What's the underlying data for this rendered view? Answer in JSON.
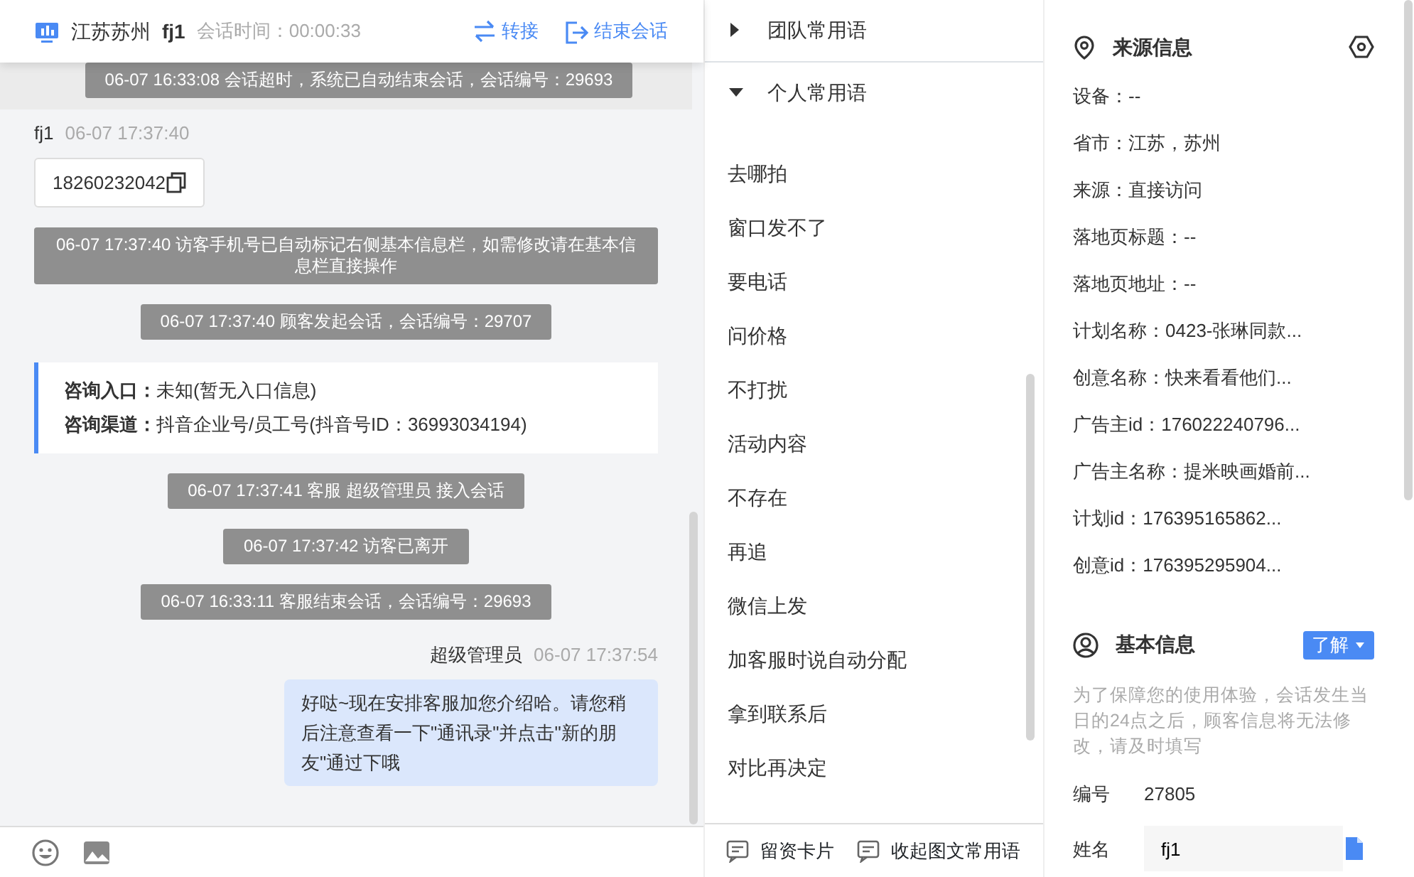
{
  "header": {
    "region": "江苏苏州",
    "visitor": "fj1",
    "session_time": "会话时间：00:00:33",
    "actions": [
      {
        "kind": "transfer",
        "label": "转接"
      },
      {
        "kind": "end",
        "label": "结束会话"
      }
    ]
  },
  "messages": [
    {
      "kind": "system",
      "text": "06-07 16:33:08 会话超时，系统已自动结束会话，会话编号：29693"
    },
    {
      "kind": "visitor",
      "sender": "fj1",
      "time": "06-07 17:37:40",
      "text": "18260232042"
    },
    {
      "kind": "system",
      "text": "06-07 17:37:40 访客手机号已自动标记右侧基本信息栏，如需修改请在基本信息栏直接操作"
    },
    {
      "kind": "system",
      "text": "06-07 17:37:40 顾客发起会话，会话编号：29707"
    },
    {
      "kind": "channel",
      "rows": [
        {
          "label": "咨询入口：",
          "value": "未知(暂无入口信息)"
        },
        {
          "label": "咨询渠道：",
          "value": "抖音企业号/员工号(抖音号ID：36993034194)"
        }
      ]
    },
    {
      "kind": "system",
      "text": "06-07 17:37:41 客服 超级管理员 接入会话"
    },
    {
      "kind": "system",
      "text": "06-07 17:37:42 访客已离开"
    },
    {
      "kind": "system",
      "text": "06-07 16:33:11 客服结束会话，会话编号：29693"
    },
    {
      "kind": "agent",
      "sender": "超级管理员",
      "time": "06-07 17:37:54",
      "text": "好哒~现在安排客服加您介绍哈。请您稍后注意查看一下\"通讯录\"并点击\"新的朋友\"通过下哦"
    }
  ],
  "phrase_groups": [
    {
      "title": "团队常用语",
      "expanded": false
    },
    {
      "title": "个人常用语",
      "expanded": true,
      "items": [
        "去哪拍",
        "窗口发不了",
        "要电话",
        "问价格",
        "不打扰",
        "活动内容",
        "不存在",
        "再追",
        "微信上发",
        "加客服时说自动分配",
        "拿到联系后",
        "对比再决定"
      ]
    }
  ],
  "phrase_footer": [
    "留资卡片",
    "收起图文常用语"
  ],
  "source_info": {
    "title": "来源信息",
    "fields": [
      "设备：--",
      "省市：江苏，苏州",
      "来源：直接访问",
      "落地页标题：--",
      "落地页地址：--",
      "计划名称：0423-张琳同款...",
      "创意名称：快来看看他们...",
      "广告主id：176022240796...",
      "广告主名称：提米映画婚前...",
      "计划id：176395165862...",
      "创意id：176395295904..."
    ]
  },
  "basic_info": {
    "title": "基本信息",
    "button": "了解",
    "notice": "为了保障您的使用体验，会话发生当日的24点之后，顾客信息将无法修改，请及时填写",
    "fields": [
      {
        "kind": "text",
        "label": "编号",
        "value": "27805"
      },
      {
        "kind": "input",
        "label": "姓名",
        "value": "fj1"
      }
    ]
  }
}
